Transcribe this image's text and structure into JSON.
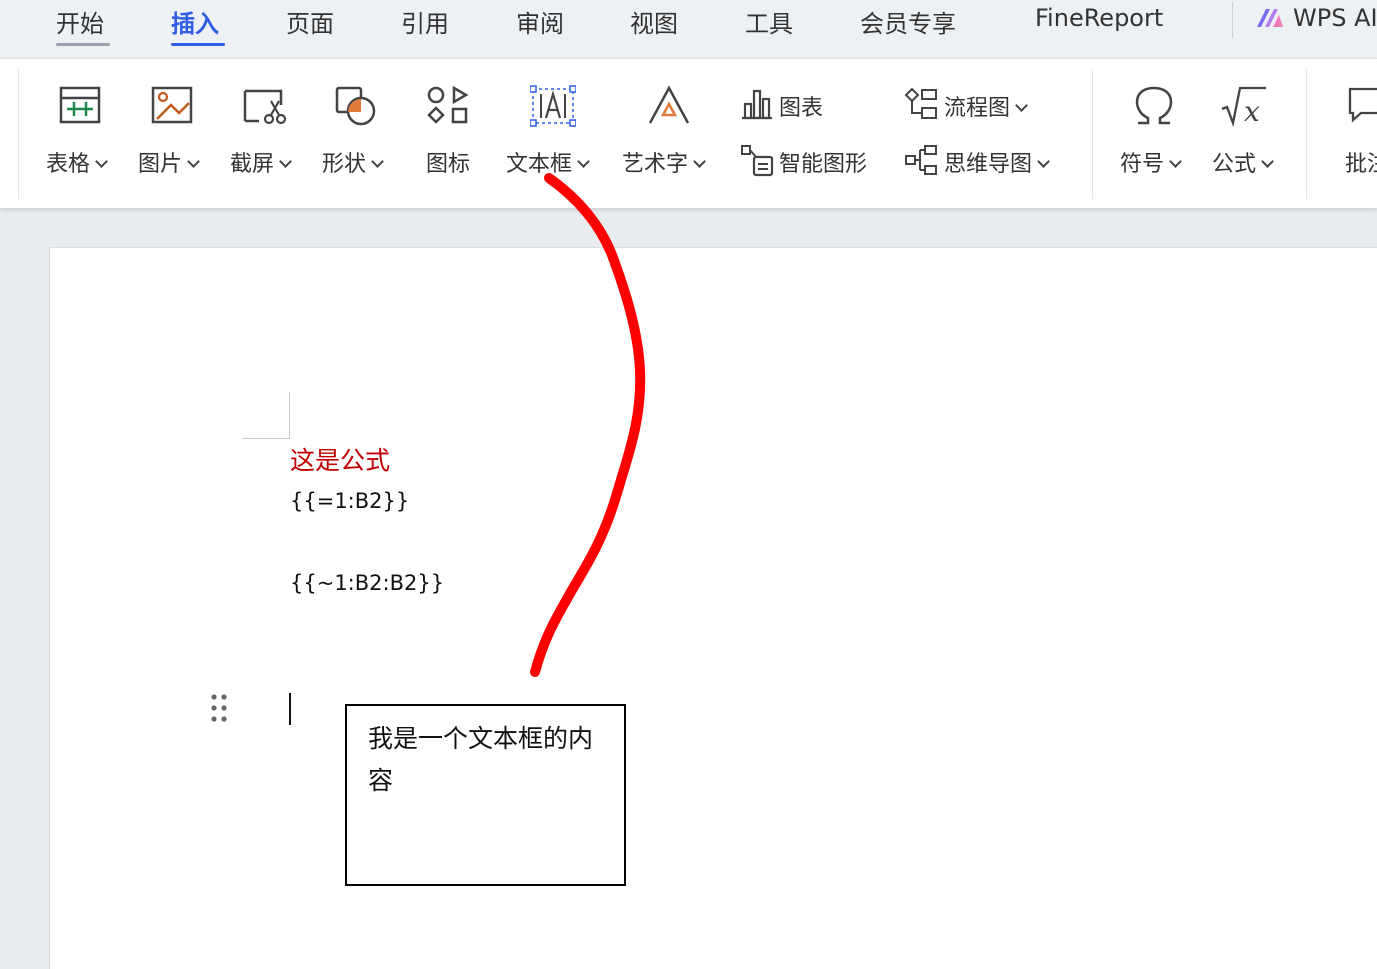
{
  "menu": {
    "tabs": [
      {
        "label": "开始"
      },
      {
        "label": "插入"
      },
      {
        "label": "页面"
      },
      {
        "label": "引用"
      },
      {
        "label": "审阅"
      },
      {
        "label": "视图"
      },
      {
        "label": "工具"
      },
      {
        "label": "会员专享"
      },
      {
        "label": "FineReport"
      },
      {
        "label": "WPS AI"
      }
    ],
    "active_tab": "插入"
  },
  "ribbon": {
    "table": "表格",
    "picture": "图片",
    "screenshot": "截屏",
    "shape": "形状",
    "icon": "图标",
    "textbox": "文本框",
    "wordart": "艺术字",
    "chart": "图表",
    "smartart": "智能图形",
    "flowchart": "流程图",
    "mindmap": "思维导图",
    "symbol": "符号",
    "formula": "公式",
    "comment": "批注"
  },
  "document": {
    "heading": "这是公式",
    "formula1": "{{=1:B2}}",
    "formula2": "{{~1:B2:B2}}",
    "textbox_text": "我是一个文本框的内容"
  },
  "colors": {
    "accent": "#2f5ee5",
    "heading_red": "#c00000",
    "annotation_red": "#ff0000"
  }
}
